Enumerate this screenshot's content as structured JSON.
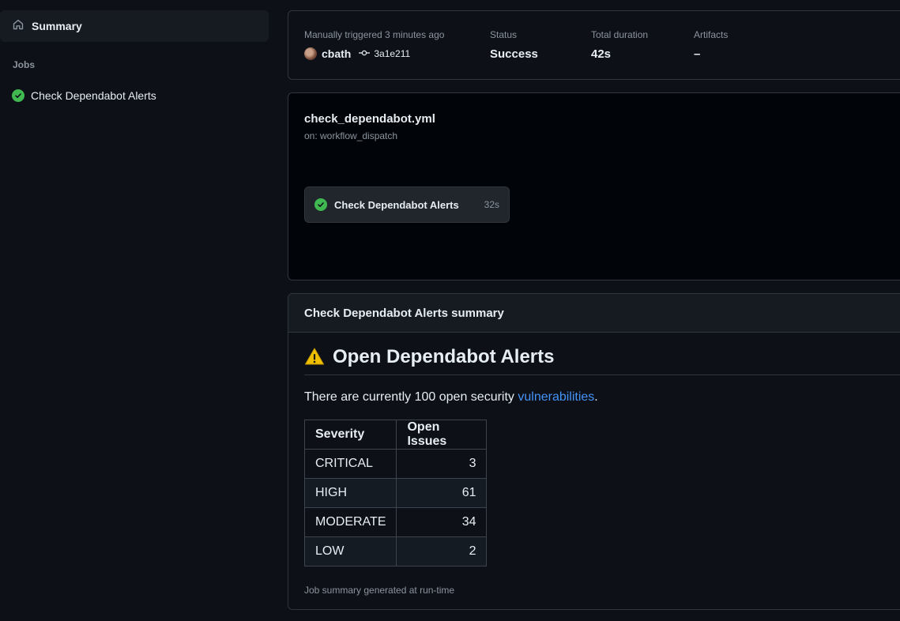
{
  "sidebar": {
    "summary_label": "Summary",
    "jobs_heading": "Jobs",
    "jobs": [
      {
        "label": "Check Dependabot Alerts",
        "status": "success"
      }
    ]
  },
  "run_info": {
    "trigger_caption": "Manually triggered 3 minutes ago",
    "actor": "cbath",
    "commit": "3a1e211",
    "status_caption": "Status",
    "status_value": "Success",
    "duration_caption": "Total duration",
    "duration_value": "42s",
    "artifacts_caption": "Artifacts",
    "artifacts_value": "–"
  },
  "workflow": {
    "file": "check_dependabot.yml",
    "trigger": "on: workflow_dispatch",
    "job_name": "Check Dependabot Alerts",
    "job_duration": "32s"
  },
  "summary": {
    "header": "Check Dependabot Alerts summary",
    "heading": "Open Dependabot Alerts",
    "text_before": "There are currently 100 open security ",
    "link_text": "vulnerabilities",
    "text_after": ".",
    "table": {
      "headers": [
        "Severity",
        "Open Issues"
      ],
      "rows": [
        [
          "CRITICAL",
          "3"
        ],
        [
          "HIGH",
          "61"
        ],
        [
          "MODERATE",
          "34"
        ],
        [
          "LOW",
          "2"
        ]
      ]
    },
    "footnote": "Job summary generated at run-time"
  },
  "colors": {
    "background": "#0d1117",
    "success": "#3fb950",
    "link": "#4493f8",
    "warning": "#f0c000"
  }
}
